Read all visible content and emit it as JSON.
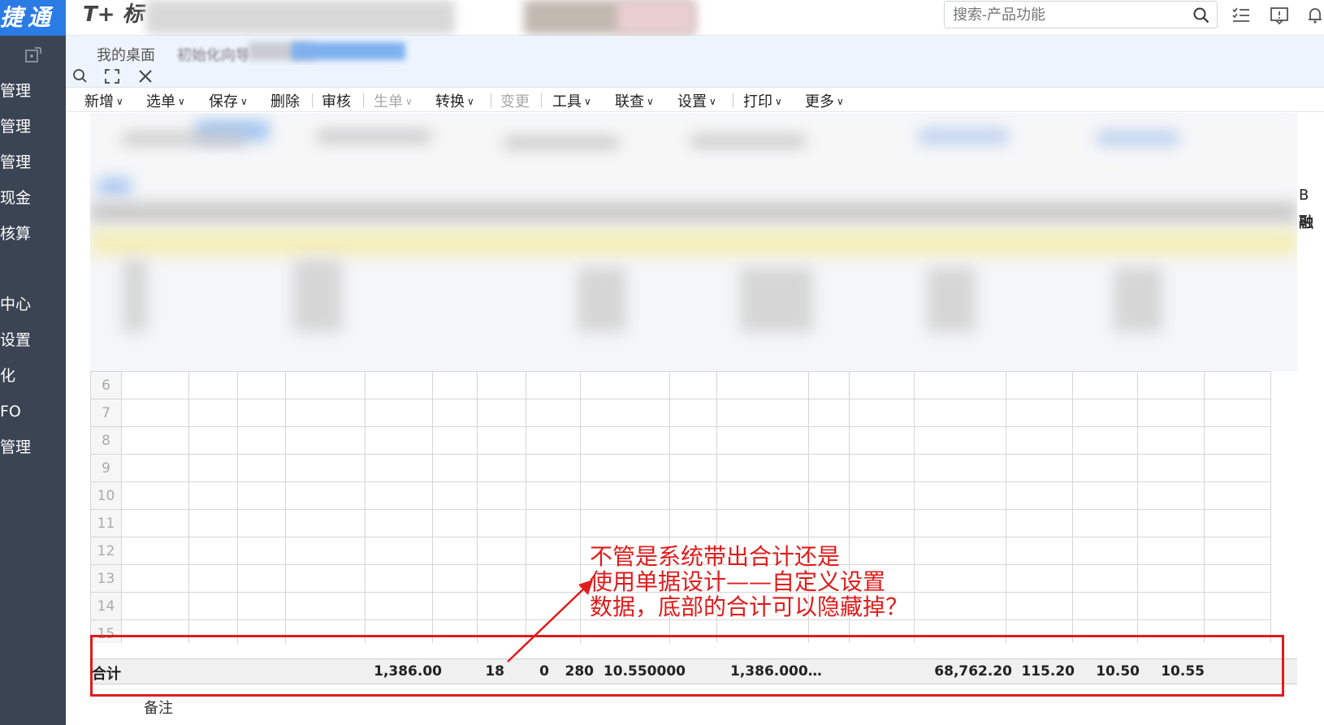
{
  "app": {
    "brand_text": "捷通",
    "product_name": "T+ 标",
    "brand_color": "#2a7be4"
  },
  "search": {
    "placeholder": "搜索-产品功能"
  },
  "sidebar": {
    "items": [
      {
        "label": "管理"
      },
      {
        "label": "管理"
      },
      {
        "label": "管理"
      },
      {
        "label": "现金"
      },
      {
        "label": "核算"
      },
      {
        "label": "中心"
      },
      {
        "label": "设置"
      },
      {
        "label": "化"
      },
      {
        "label": "FO"
      },
      {
        "label": "管理"
      }
    ]
  },
  "tabs": [
    {
      "label": "我的桌面"
    },
    {
      "label": "初始化向导"
    }
  ],
  "toolbar": {
    "buttons": [
      {
        "label": "新增",
        "dropdown": true,
        "disabled": false
      },
      {
        "label": "选单",
        "dropdown": true,
        "disabled": false
      },
      {
        "label": "保存",
        "dropdown": true,
        "disabled": false
      },
      {
        "label": "删除",
        "dropdown": false,
        "disabled": false
      },
      {
        "label": "审核",
        "dropdown": false,
        "disabled": false
      },
      {
        "label": "生单",
        "dropdown": true,
        "disabled": true
      },
      {
        "label": "转换",
        "dropdown": true,
        "disabled": false
      },
      {
        "label": "变更",
        "dropdown": false,
        "disabled": true
      },
      {
        "label": "工具",
        "dropdown": true,
        "disabled": false
      },
      {
        "label": "联查",
        "dropdown": true,
        "disabled": false
      },
      {
        "label": "设置",
        "dropdown": true,
        "disabled": false
      },
      {
        "label": "打印",
        "dropdown": true,
        "disabled": false
      },
      {
        "label": "更多",
        "dropdown": true,
        "disabled": false
      }
    ]
  },
  "grid": {
    "row_numbers": [
      "6",
      "7",
      "8",
      "9",
      "10",
      "11",
      "12",
      "13",
      "14",
      "15"
    ]
  },
  "totals": {
    "label": "合计",
    "values": [
      "1,386.00",
      "18",
      "0",
      "280",
      "10.550000",
      "1,386.000…",
      "68,762.20",
      "115.20",
      "10.50",
      "10.55"
    ]
  },
  "remark_label": "备注",
  "annotation": {
    "lines": [
      "不管是系统带出合计还是",
      "使用单据设计——自定义设置",
      "数据，底部的合计可以隐藏掉？"
    ],
    "color": "#e01b1b"
  },
  "right_edge_fragments": [
    "B",
    "融"
  ]
}
